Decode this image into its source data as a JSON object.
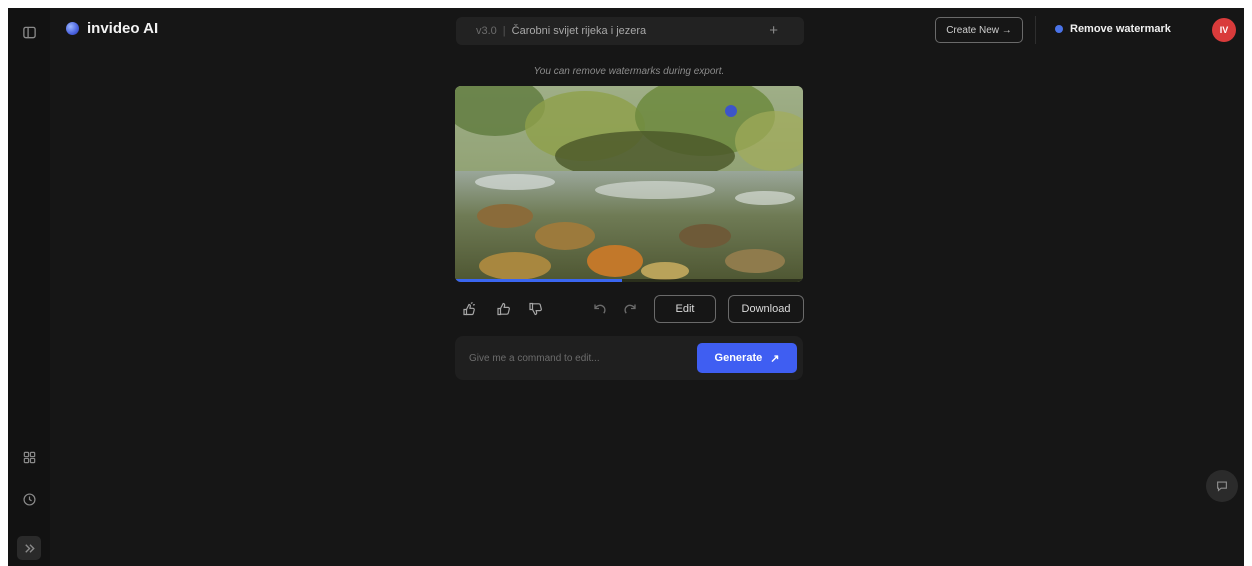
{
  "sidebar": {
    "toggle_icon": "sidebar-panel-icon",
    "templates_icon": "grid-icon",
    "history_icon": "clock-icon",
    "expand_icon": "double-chevron-right-icon"
  },
  "header": {
    "brand_name": "invideo AI",
    "project_prefix": "v3.0",
    "project_title": "Čarobni svijet rijeka i jezera",
    "add_symbol": "+",
    "create_new_label": "Create New →",
    "remove_watermark_label": "Remove watermark",
    "avatar_initials": "IV"
  },
  "player": {
    "watermark_notice": "You can remove watermarks during export.",
    "progress_percent": 48
  },
  "actions": {
    "edit_label": "Edit",
    "download_label": "Download"
  },
  "command": {
    "placeholder": "Give me a command to edit...",
    "value": "",
    "generate_label": "Generate",
    "generate_icon": "↗"
  },
  "colors": {
    "accent": "#3f5ef2",
    "background": "#161616",
    "avatar": "#d93b3b"
  }
}
